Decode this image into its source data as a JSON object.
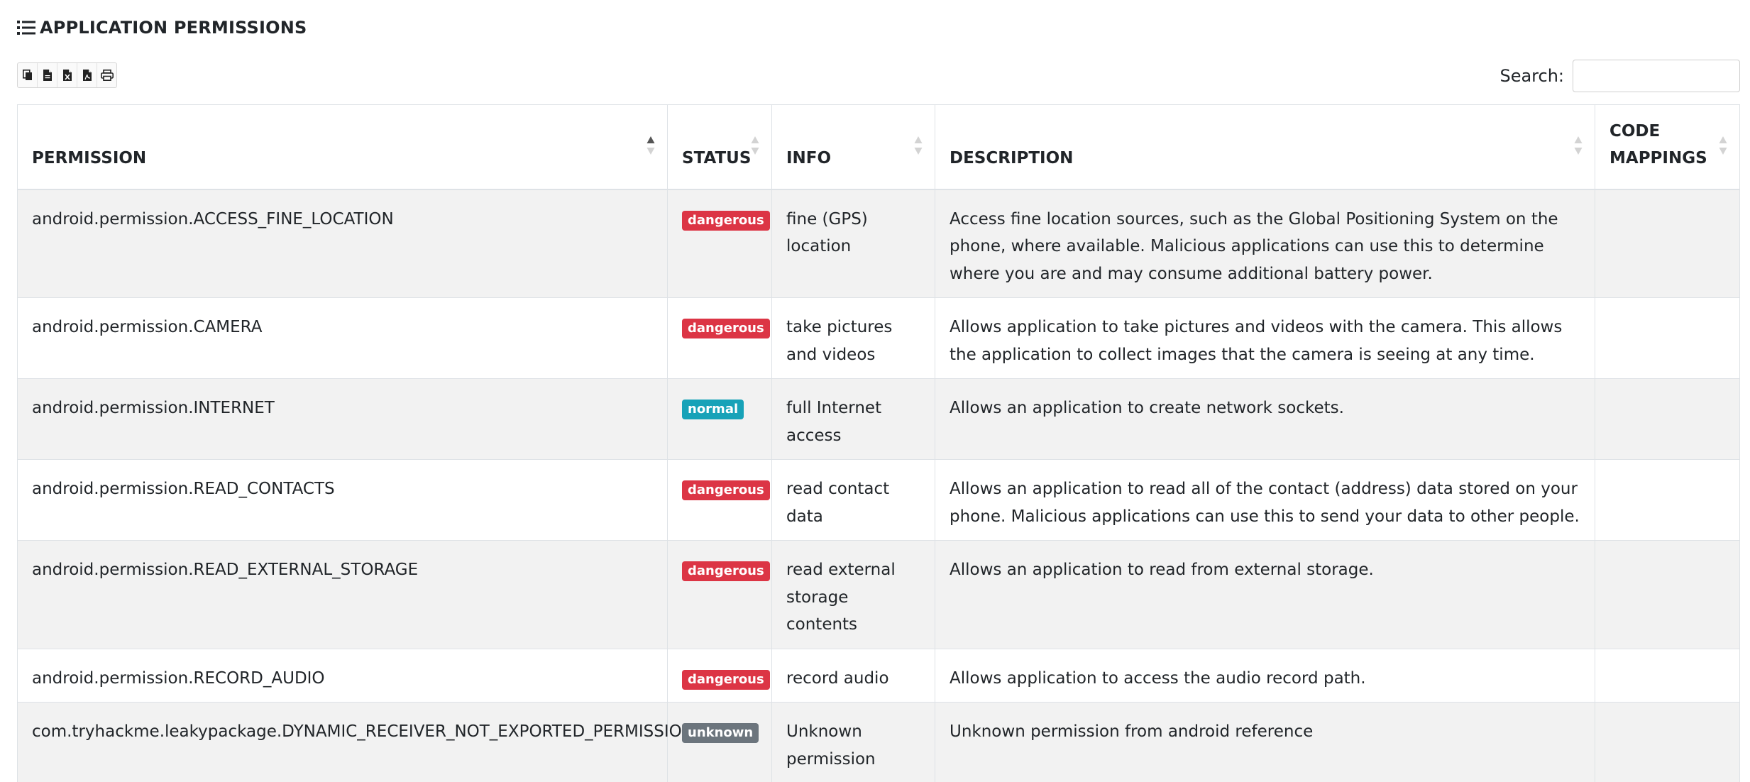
{
  "section": {
    "title": "APPLICATION PERMISSIONS",
    "icon": "list-icon"
  },
  "toolbar": {
    "buttons": [
      {
        "name": "copy-icon"
      },
      {
        "name": "csv-icon"
      },
      {
        "name": "excel-icon"
      },
      {
        "name": "pdf-icon"
      },
      {
        "name": "print-icon"
      }
    ]
  },
  "search": {
    "label": "Search:",
    "value": "",
    "placeholder": ""
  },
  "table": {
    "headers": {
      "permission": "PERMISSION",
      "status": "STATUS",
      "info": "INFO",
      "description": "DESCRIPTION",
      "code_mappings_line1": "CODE",
      "code_mappings_line2": "MAPPINGS"
    },
    "rows": [
      {
        "permission": "android.permission.ACCESS_FINE_LOCATION",
        "status": "dangerous",
        "info": "fine (GPS) location",
        "description": "Access fine location sources, such as the Global Positioning System on the phone, where available. Malicious applications can use this to determine where you are and may consume additional battery power.",
        "code_mappings": ""
      },
      {
        "permission": "android.permission.CAMERA",
        "status": "dangerous",
        "info": "take pictures and videos",
        "description": "Allows application to take pictures and videos with the camera. This allows the application to collect images that the camera is seeing at any time.",
        "code_mappings": ""
      },
      {
        "permission": "android.permission.INTERNET",
        "status": "normal",
        "info": "full Internet access",
        "description": "Allows an application to create network sockets.",
        "code_mappings": ""
      },
      {
        "permission": "android.permission.READ_CONTACTS",
        "status": "dangerous",
        "info": "read contact data",
        "description": "Allows an application to read all of the contact (address) data stored on your phone. Malicious applications can use this to send your data to other people.",
        "code_mappings": ""
      },
      {
        "permission": "android.permission.READ_EXTERNAL_STORAGE",
        "status": "dangerous",
        "info": "read external storage contents",
        "description": "Allows an application to read from external storage.",
        "code_mappings": ""
      },
      {
        "permission": "android.permission.RECORD_AUDIO",
        "status": "dangerous",
        "info": "record audio",
        "description": "Allows application to access the audio record path.",
        "code_mappings": ""
      },
      {
        "permission": "com.tryhackme.leakypackage.DYNAMIC_RECEIVER_NOT_EXPORTED_PERMISSION",
        "status": "unknown",
        "info": "Unknown permission",
        "description": "Unknown permission from android reference",
        "code_mappings": ""
      }
    ]
  },
  "colors": {
    "dangerous": "#dc3545",
    "normal": "#17a2b8",
    "unknown": "#6c757d",
    "stripe": "#f2f2f2"
  }
}
